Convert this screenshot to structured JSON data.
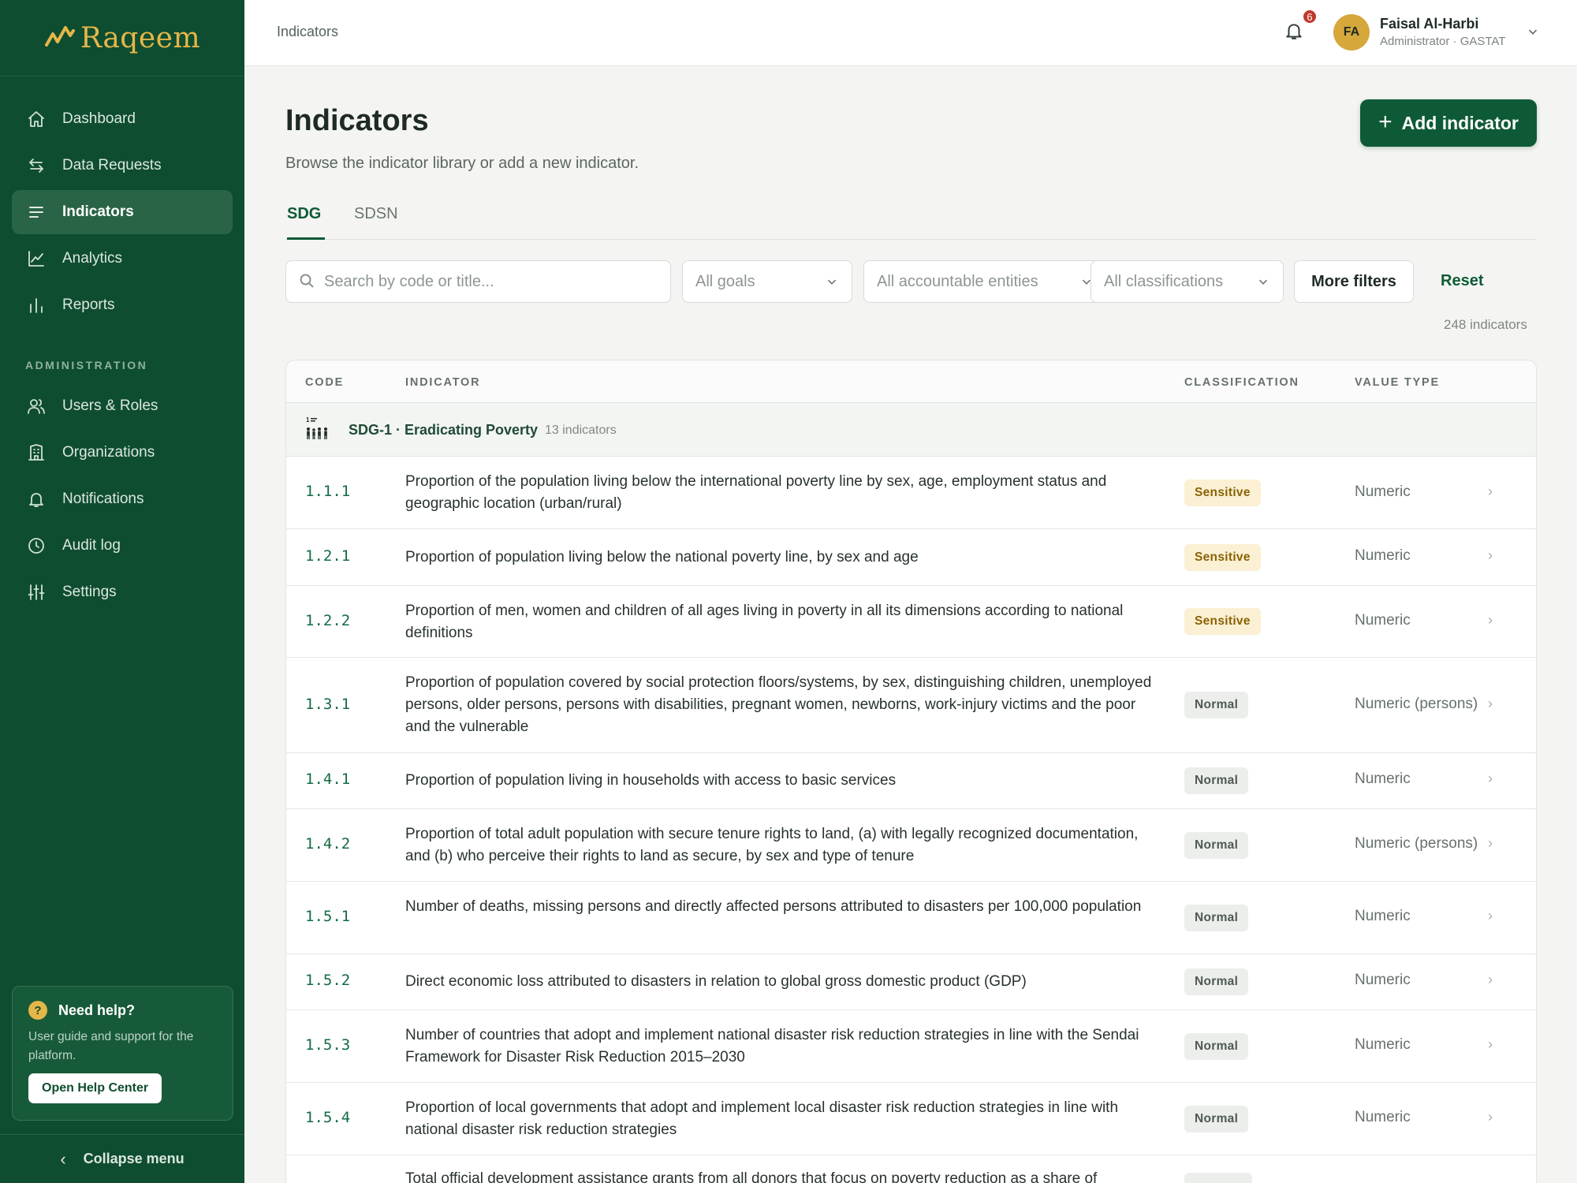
{
  "app": {
    "brand": "Raqeem"
  },
  "sidebar": {
    "nav": [
      {
        "label": "Dashboard",
        "icon": "home-icon"
      },
      {
        "label": "Data Requests",
        "icon": "arrows-swap-icon"
      },
      {
        "label": "Indicators",
        "icon": "list-icon",
        "active": true
      },
      {
        "label": "Analytics",
        "icon": "line-chart-icon"
      },
      {
        "label": "Reports",
        "icon": "bar-chart-icon"
      }
    ],
    "admin_label": "ADMINISTRATION",
    "admin": [
      {
        "label": "Users & Roles",
        "icon": "users-icon"
      },
      {
        "label": "Organizations",
        "icon": "building-icon"
      },
      {
        "label": "Notifications",
        "icon": "bell-icon"
      },
      {
        "label": "Audit log",
        "icon": "clock-icon"
      },
      {
        "label": "Settings",
        "icon": "sliders-icon"
      }
    ],
    "help": {
      "title": "Need help?",
      "text": "User guide and support for the platform.",
      "button": "Open Help Center"
    },
    "collapse": "Collapse menu"
  },
  "topbar": {
    "breadcrumb": "Indicators",
    "notifications_count": "6",
    "user": {
      "initials": "FA",
      "name": "Faisal Al-Harbi",
      "role": "Administrator · GASTAT"
    }
  },
  "page": {
    "title": "Indicators",
    "subtitle": "Browse the indicator library or add a new indicator.",
    "add_button": "Add indicator",
    "tabs": [
      "SDG",
      "SDSN"
    ],
    "filters": {
      "search_placeholder": "Search by code or title...",
      "goals": "All goals",
      "entities": "All accountable entities",
      "classifications": "All classifications",
      "more": "More filters",
      "reset": "Reset"
    },
    "count": "248 indicators"
  },
  "table": {
    "columns": [
      "CODE",
      "INDICATOR",
      "CLASSIFICATION",
      "VALUE TYPE"
    ],
    "group": {
      "title": "SDG-1 · Eradicating Poverty",
      "count": "13 indicators"
    },
    "rows": [
      {
        "code": "1.1.1",
        "indicator": "Proportion of the population living below the international poverty line by sex, age, employment status and geographic location (urban/rural)",
        "classification": "Sensitive",
        "value_type": "Numeric"
      },
      {
        "code": "1.2.1",
        "indicator": "Proportion of population living below the national poverty line, by sex and age",
        "classification": "Sensitive",
        "value_type": "Numeric"
      },
      {
        "code": "1.2.2",
        "indicator": "Proportion of men, women and children of all ages living in poverty in all its dimensions according to national definitions",
        "classification": "Sensitive",
        "value_type": "Numeric"
      },
      {
        "code": "1.3.1",
        "indicator": "Proportion of population covered by social protection floors/systems, by sex, distinguishing children, unemployed persons, older persons, persons with disabilities, pregnant women, newborns, work-injury victims and the poor and the vulnerable",
        "classification": "Normal",
        "value_type": "Numeric (persons)"
      },
      {
        "code": "1.4.1",
        "indicator": "Proportion of population living in households with access to basic services",
        "classification": "Normal",
        "value_type": "Numeric"
      },
      {
        "code": "1.4.2",
        "indicator": "Proportion of total adult population with secure tenure rights to land, (a) with legally recognized documentation, and (b) who perceive their rights to land as secure, by sex and type of tenure",
        "classification": "Normal",
        "value_type": "Numeric (persons)"
      },
      {
        "code": "1.5.1",
        "indicator": "Number of deaths, missing persons and directly affected persons attributed to disasters per 100,000 population",
        "classification": "Normal",
        "value_type": "Numeric"
      },
      {
        "code": "1.5.2",
        "indicator": "Direct economic loss attributed to disasters in relation to global gross domestic product (GDP)",
        "classification": "Normal",
        "value_type": "Numeric"
      },
      {
        "code": "1.5.3",
        "indicator": "Number of countries that adopt and implement national disaster risk reduction strategies in line with the Sendai Framework for Disaster Risk Reduction 2015–2030",
        "classification": "Normal",
        "value_type": "Numeric"
      },
      {
        "code": "1.5.4",
        "indicator": "Proportion of local governments that adopt and implement local disaster risk reduction strategies in line with national disaster risk reduction strategies",
        "classification": "Normal",
        "value_type": "Numeric"
      },
      {
        "code": "",
        "indicator": "Total official development assistance grants from all donors that focus on poverty reduction as a share of",
        "classification": "",
        "value_type": ""
      }
    ]
  },
  "colors": {
    "sidebar": "#0f4d30",
    "accent": "#0f5a36",
    "brand_gold": "#e5b64a",
    "sensitive_bg": "#fbf0d3",
    "normal_bg": "#eceeec"
  }
}
